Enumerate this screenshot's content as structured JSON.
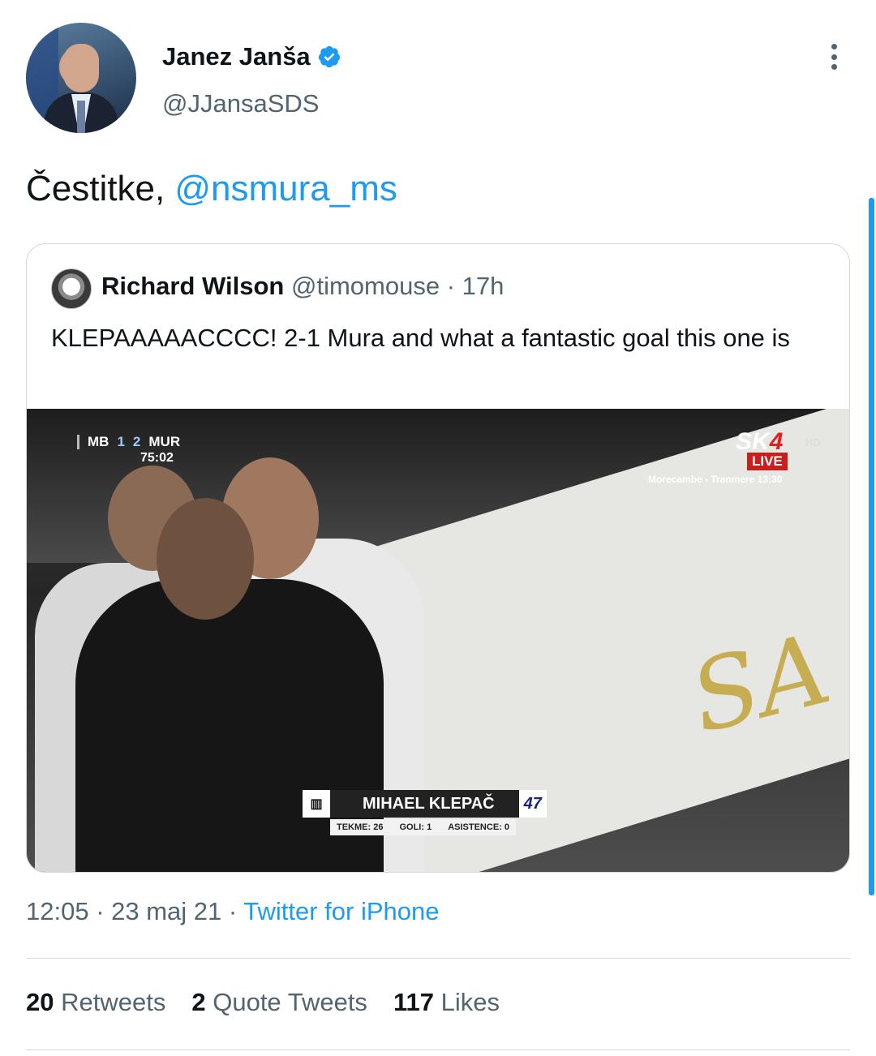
{
  "tweet": {
    "author_name": "Janez Janša",
    "author_handle": "@JJansaSDS",
    "text_prefix": "Čestitke, ",
    "mention": "@nsmura_ms",
    "timestamp": "12:05 · 23 maj 21 · ",
    "source": "Twitter for iPhone"
  },
  "quoted": {
    "author_name": "Richard Wilson",
    "author_handle": "@timomouse",
    "age": " · 17h",
    "text": "KLEPAAAAACCCC! 2-1 Mura and what a fantastic goal this one is"
  },
  "video_overlay": {
    "home_team": "MB",
    "home_score": "1",
    "away_score": "2",
    "away_team": "MUR",
    "clock": "75:02",
    "channel": "SK",
    "channel_number": "4",
    "hd": "HD",
    "live": "LIVE",
    "next_match": "Morecambe - Tranmere 13:30",
    "player_name": "MIHAEL KLEPAČ",
    "player_number": "47",
    "stat_apps": "TEKME: 26",
    "stat_goals": "GOLI: 1",
    "stat_assists": "ASISTENCE: 0",
    "banner_text": "SA"
  },
  "engagement": {
    "retweets_count": "20",
    "retweets_label": "Retweets",
    "quotes_count": "2",
    "quotes_label": "Quote Tweets",
    "likes_count": "117",
    "likes_label": "Likes"
  },
  "colors": {
    "accent": "#1d9bf0",
    "secondary_text": "#536471",
    "border": "#cfd9de"
  }
}
